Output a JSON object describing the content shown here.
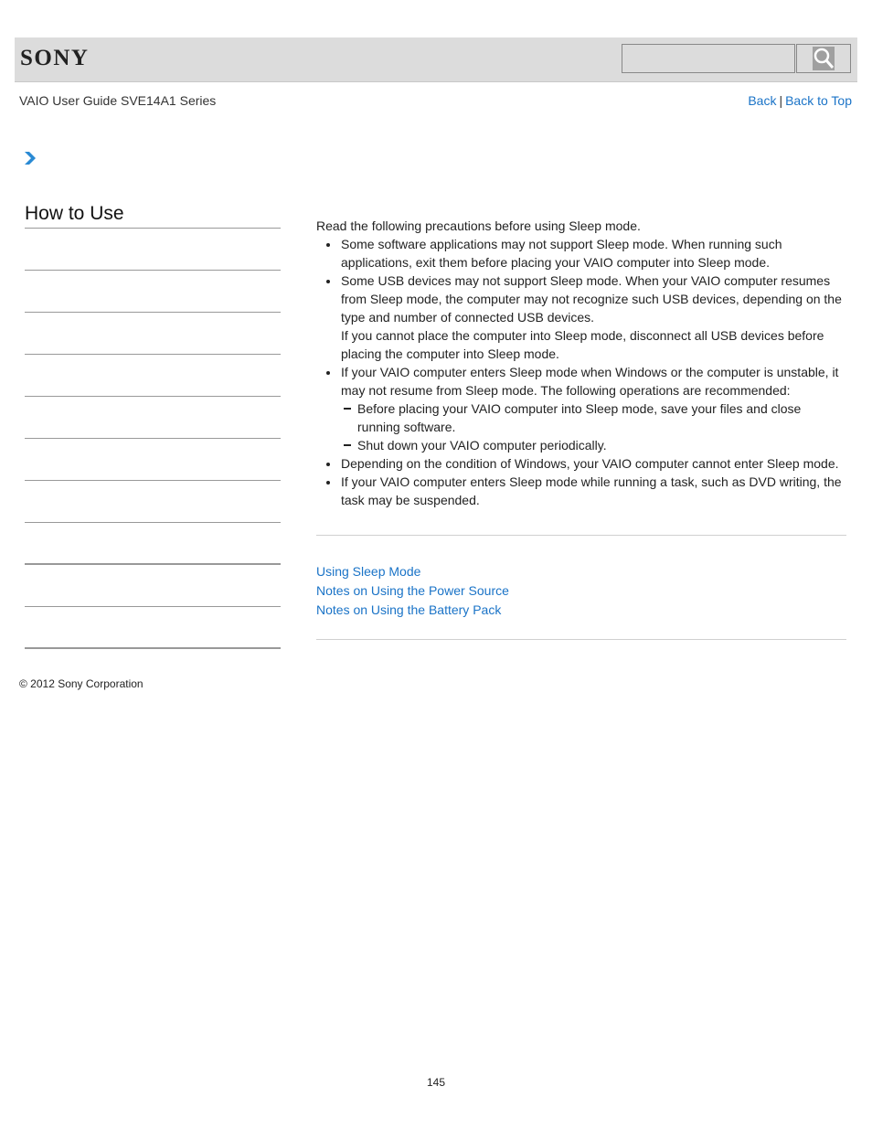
{
  "header": {
    "logo": "SONY",
    "search": {
      "value": "",
      "placeholder": ""
    },
    "search_button_icon": "magnifier-icon"
  },
  "guide_title": "VAIO User Guide SVE14A1 Series",
  "nav": {
    "back": "Back",
    "separator": "|",
    "back_to_top": "Back to Top"
  },
  "breadcrumb_icon": "chevron-right-icon",
  "sidebar": {
    "title": "How to Use",
    "items": [
      "",
      "",
      "",
      "",
      "",
      "",
      "",
      "",
      "",
      ""
    ]
  },
  "content": {
    "intro": "Read the following precautions before using Sleep mode.",
    "bullets": [
      {
        "text": "Some software applications may not support Sleep mode. When running such applications, exit them before placing your VAIO computer into Sleep mode."
      },
      {
        "text": "Some USB devices may not support Sleep mode. When your VAIO computer resumes from Sleep mode, the computer may not recognize such USB devices, depending on the type and number of connected USB devices.",
        "extra": "If you cannot place the computer into Sleep mode, disconnect all USB devices before placing the computer into Sleep mode."
      },
      {
        "text": "If your VAIO computer enters Sleep mode when Windows or the computer is unstable, it may not resume from Sleep mode. The following operations are recommended:",
        "sub": [
          "Before placing your VAIO computer into Sleep mode, save your files and close running software.",
          "Shut down your VAIO computer periodically."
        ]
      },
      {
        "text": "Depending on the condition of Windows, your VAIO computer cannot enter Sleep mode."
      },
      {
        "text": "If your VAIO computer enters Sleep mode while running a task, such as DVD writing, the task may be suspended."
      }
    ]
  },
  "related_links": [
    "Using Sleep Mode",
    "Notes on Using the Power Source",
    "Notes on Using the Battery Pack"
  ],
  "footer": {
    "copyright": "© 2012 Sony Corporation",
    "page_number": "145"
  },
  "colors": {
    "link": "#1a73c7",
    "header_bg": "#dcdcdc",
    "chevron": "#2a8ad4"
  }
}
